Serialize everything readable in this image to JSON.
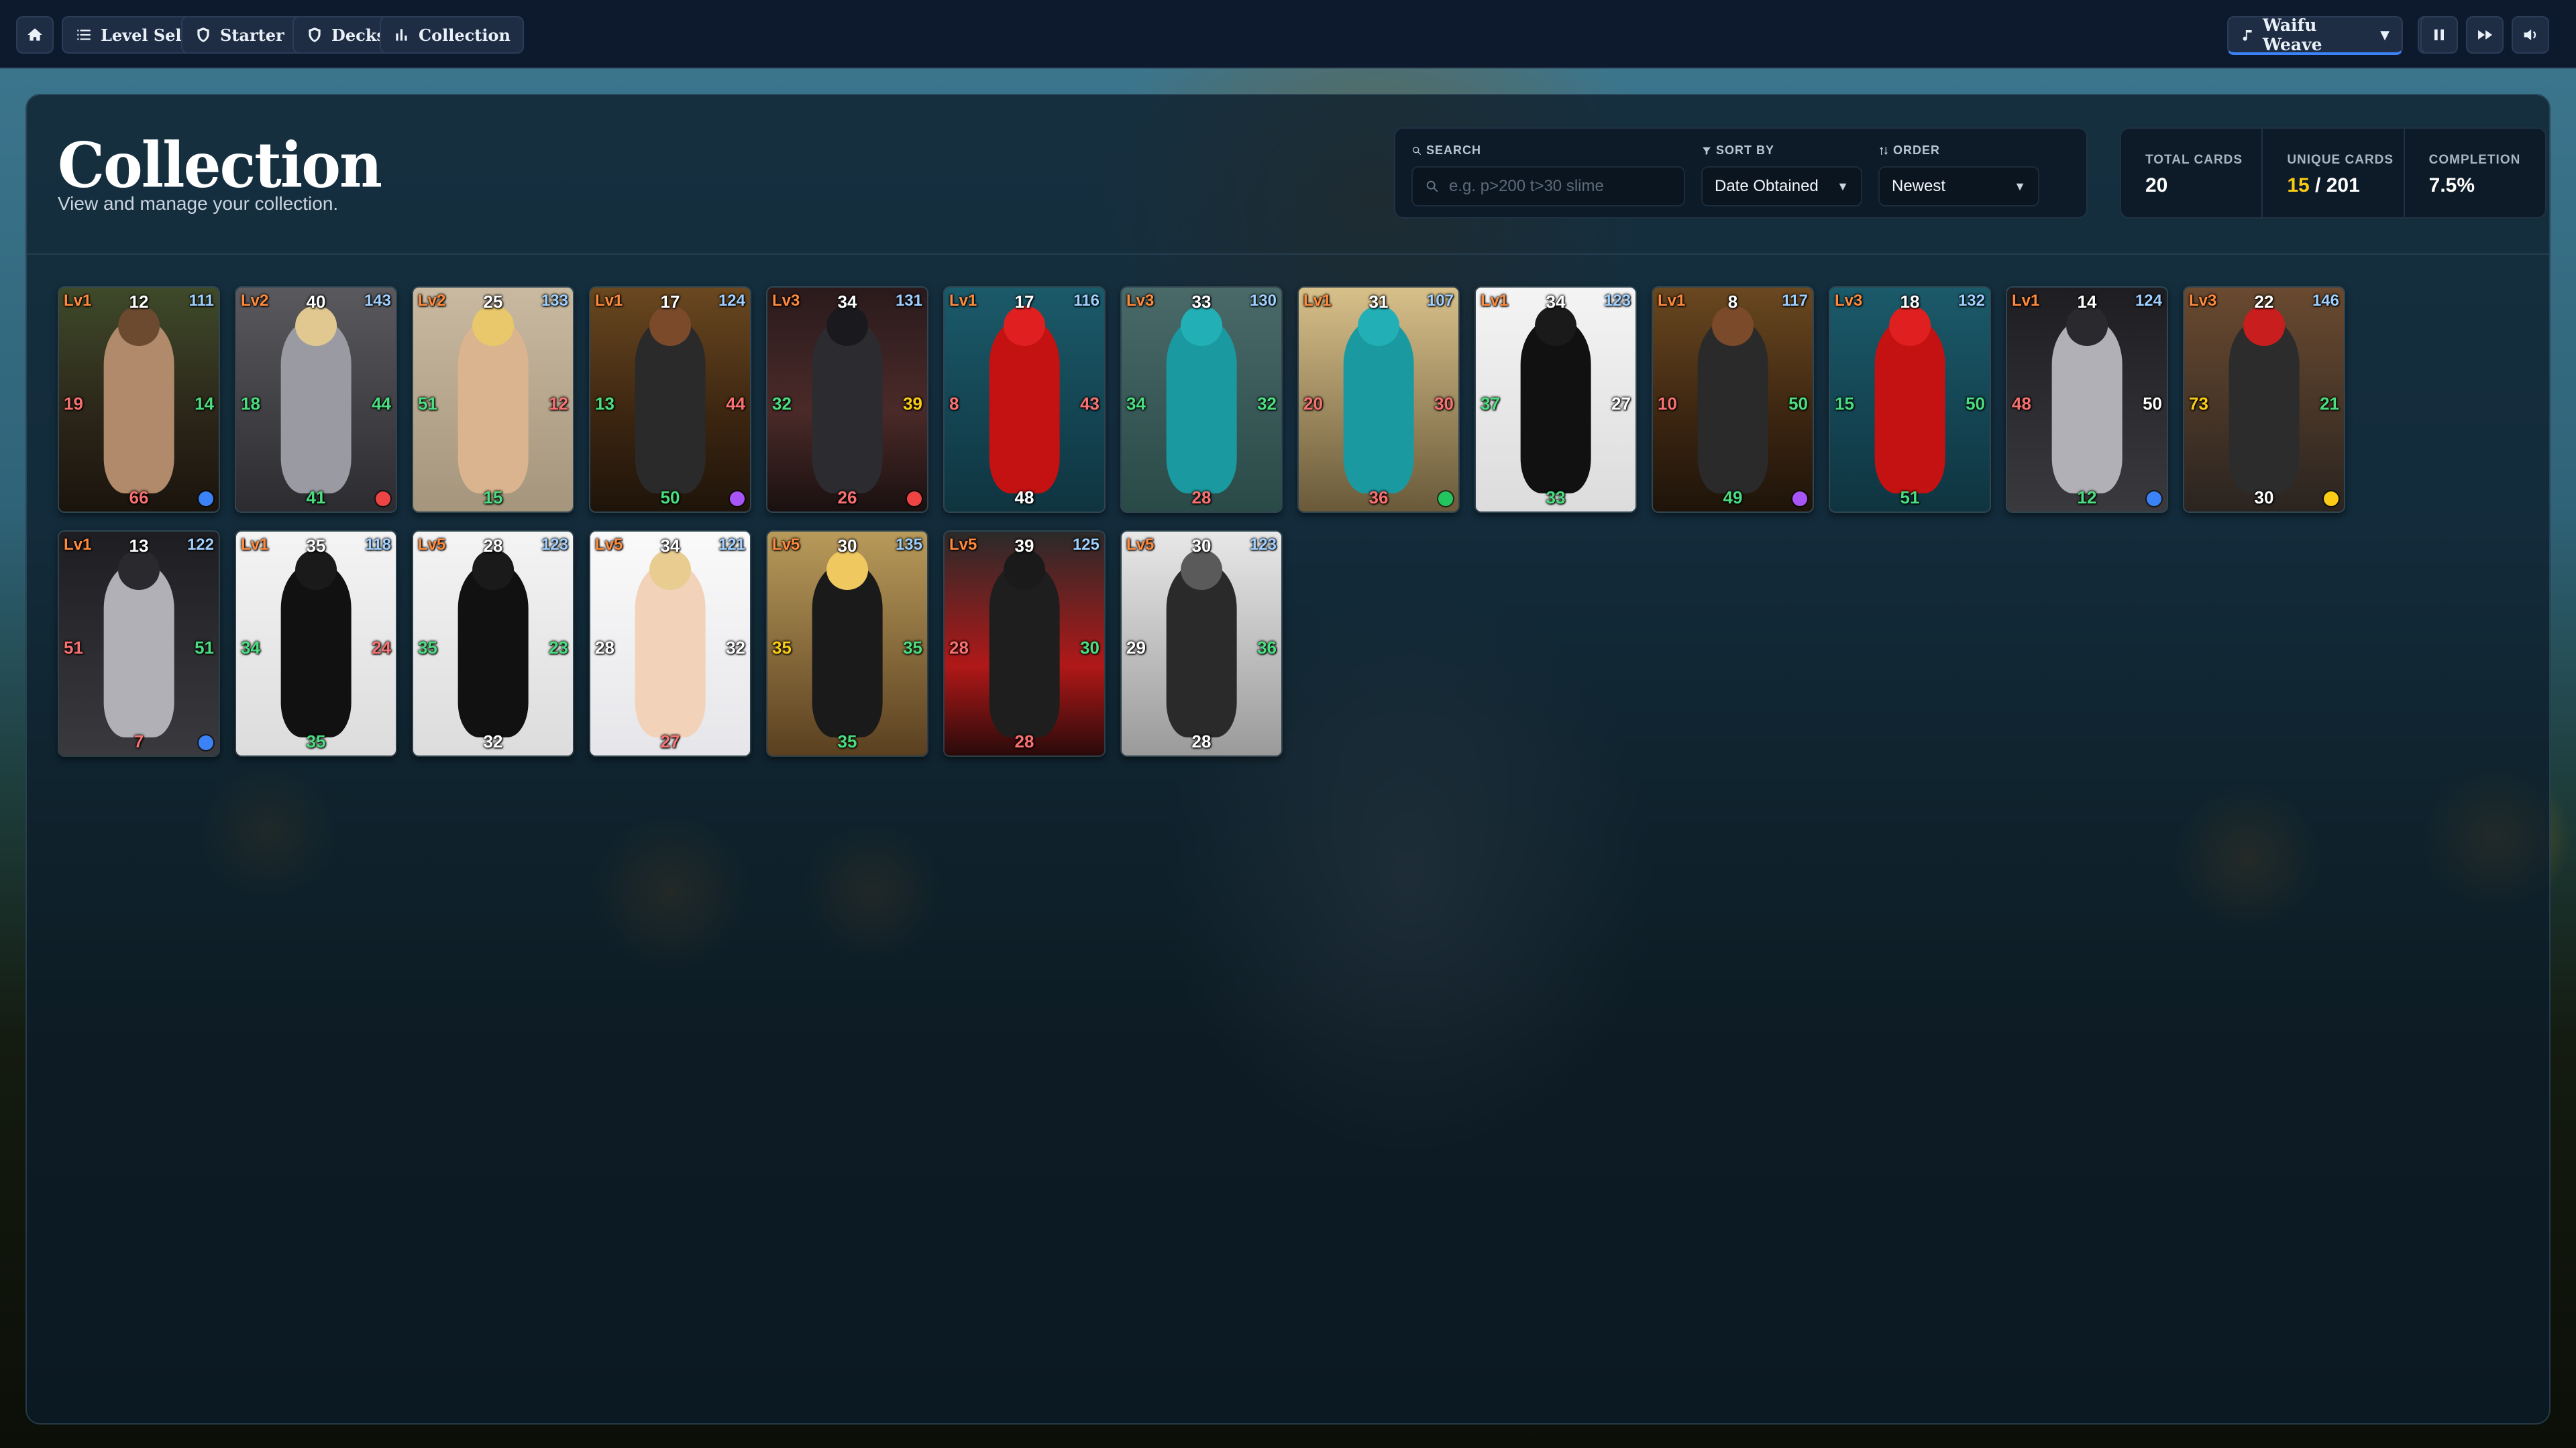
{
  "nav": {
    "level_select": "Level Select",
    "starter": "Starter",
    "decks": "Decks",
    "collection": "Collection"
  },
  "music": {
    "track": "Waifu Weave"
  },
  "page": {
    "title": "Collection",
    "subtitle": "View and manage your collection."
  },
  "filters": {
    "search_label": "SEARCH",
    "search_placeholder": "e.g. p>200 t>30 slime",
    "sort_label": "SORT BY",
    "sort_value": "Date Obtained",
    "order_label": "ORDER",
    "order_value": "Newest"
  },
  "stats": {
    "total_label": "TOTAL CARDS",
    "total_value": "20",
    "unique_label": "UNIQUE CARDS",
    "unique_owned": "15",
    "unique_sep": "/",
    "unique_total": "201",
    "completion_label": "COMPLETION",
    "completion_value": "7.5%"
  },
  "colors": {
    "level": "#ff8a3d",
    "id": "#9fd0ff",
    "stat_green": "#4ade80",
    "stat_red": "#f87171",
    "stat_yellow": "#facc15",
    "stat_white": "#ffffff",
    "accent": "#3b82f6"
  },
  "cards": [
    {
      "lv": "Lv1",
      "top": "12",
      "id": "111",
      "left": "19",
      "left_c": "red",
      "right": "14",
      "right_c": "green",
      "bottom": "66",
      "bottom_c": "red",
      "elem": "water-icon",
      "bg": "forest-brown"
    },
    {
      "lv": "Lv2",
      "top": "40",
      "id": "143",
      "left": "18",
      "left_c": "green",
      "right": "44",
      "right_c": "green",
      "bottom": "41",
      "bottom_c": "green",
      "elem": "arrow-icon",
      "bg": "armor-gray"
    },
    {
      "lv": "Lv2",
      "top": "25",
      "id": "133",
      "left": "51",
      "left_c": "green",
      "right": "12",
      "right_c": "red",
      "bottom": "15",
      "bottom_c": "green",
      "elem": "",
      "bg": "beige"
    },
    {
      "lv": "Lv1",
      "top": "17",
      "id": "124",
      "left": "13",
      "left_c": "green",
      "right": "44",
      "right_c": "red",
      "bottom": "50",
      "bottom_c": "green",
      "elem": "potion-icon",
      "bg": "tavern"
    },
    {
      "lv": "Lv3",
      "top": "34",
      "id": "131",
      "left": "32",
      "left_c": "green",
      "right": "39",
      "right_c": "yellow",
      "bottom": "26",
      "bottom_c": "red",
      "elem": "fire-icon",
      "bg": "dark-demon"
    },
    {
      "lv": "Lv1",
      "top": "17",
      "id": "116",
      "left": "8",
      "left_c": "red",
      "right": "43",
      "right_c": "red",
      "bottom": "48",
      "bottom_c": "white",
      "elem": "",
      "bg": "red-slime"
    },
    {
      "lv": "Lv3",
      "top": "33",
      "id": "130",
      "left": "34",
      "left_c": "green",
      "right": "32",
      "right_c": "green",
      "bottom": "28",
      "bottom_c": "red",
      "elem": "",
      "bg": "teal-slime"
    },
    {
      "lv": "Lv1",
      "top": "31",
      "id": "107",
      "left": "20",
      "left_c": "red",
      "right": "30",
      "right_c": "red",
      "bottom": "36",
      "bottom_c": "red",
      "elem": "leaf-icon",
      "bg": "teal-slime-sun"
    },
    {
      "lv": "Lv1",
      "top": "34",
      "id": "123",
      "left": "37",
      "left_c": "green",
      "right": "27",
      "right_c": "white",
      "bottom": "33",
      "bottom_c": "green",
      "elem": "",
      "bg": "white-sword"
    },
    {
      "lv": "Lv1",
      "top": "8",
      "id": "117",
      "left": "10",
      "left_c": "red",
      "right": "50",
      "right_c": "green",
      "bottom": "49",
      "bottom_c": "green",
      "elem": "potion-icon",
      "bg": "tavern"
    },
    {
      "lv": "Lv3",
      "top": "18",
      "id": "132",
      "left": "15",
      "left_c": "green",
      "right": "50",
      "right_c": "green",
      "bottom": "51",
      "bottom_c": "green",
      "elem": "",
      "bg": "red-slime"
    },
    {
      "lv": "Lv1",
      "top": "14",
      "id": "124",
      "left": "48",
      "left_c": "red",
      "right": "50",
      "right_c": "white",
      "bottom": "12",
      "bottom_c": "green",
      "elem": "water-icon",
      "bg": "spider"
    },
    {
      "lv": "Lv3",
      "top": "22",
      "id": "146",
      "left": "73",
      "left_c": "yellow",
      "right": "21",
      "right_c": "green",
      "bottom": "30",
      "bottom_c": "white",
      "elem": "eye-icon",
      "bg": "red-hair"
    },
    {
      "lv": "Lv1",
      "top": "13",
      "id": "122",
      "left": "51",
      "left_c": "red",
      "right": "51",
      "right_c": "green",
      "bottom": "7",
      "bottom_c": "red",
      "elem": "water-icon",
      "bg": "spider"
    },
    {
      "lv": "Lv1",
      "top": "35",
      "id": "118",
      "left": "34",
      "left_c": "green",
      "right": "24",
      "right_c": "red",
      "bottom": "35",
      "bottom_c": "green",
      "elem": "",
      "bg": "white-sword"
    },
    {
      "lv": "Lv5",
      "top": "28",
      "id": "123",
      "left": "35",
      "left_c": "green",
      "right": "23",
      "right_c": "green",
      "bottom": "32",
      "bottom_c": "white",
      "elem": "",
      "bg": "white-sword"
    },
    {
      "lv": "Lv5",
      "top": "34",
      "id": "121",
      "left": "28",
      "left_c": "white",
      "right": "32",
      "right_c": "white",
      "bottom": "27",
      "bottom_c": "red",
      "elem": "",
      "bg": "bunny"
    },
    {
      "lv": "Lv5",
      "top": "30",
      "id": "135",
      "left": "35",
      "left_c": "yellow",
      "right": "35",
      "right_c": "green",
      "bottom": "35",
      "bottom_c": "green",
      "elem": "",
      "bg": "blonde-maid"
    },
    {
      "lv": "Lv5",
      "top": "39",
      "id": "125",
      "left": "28",
      "left_c": "red",
      "right": "30",
      "right_c": "green",
      "bottom": "28",
      "bottom_c": "red",
      "elem": "",
      "bg": "red-cape"
    },
    {
      "lv": "Lv5",
      "top": "30",
      "id": "123",
      "left": "29",
      "left_c": "white",
      "right": "36",
      "right_c": "green",
      "bottom": "28",
      "bottom_c": "white",
      "elem": "",
      "bg": "wolf"
    }
  ]
}
